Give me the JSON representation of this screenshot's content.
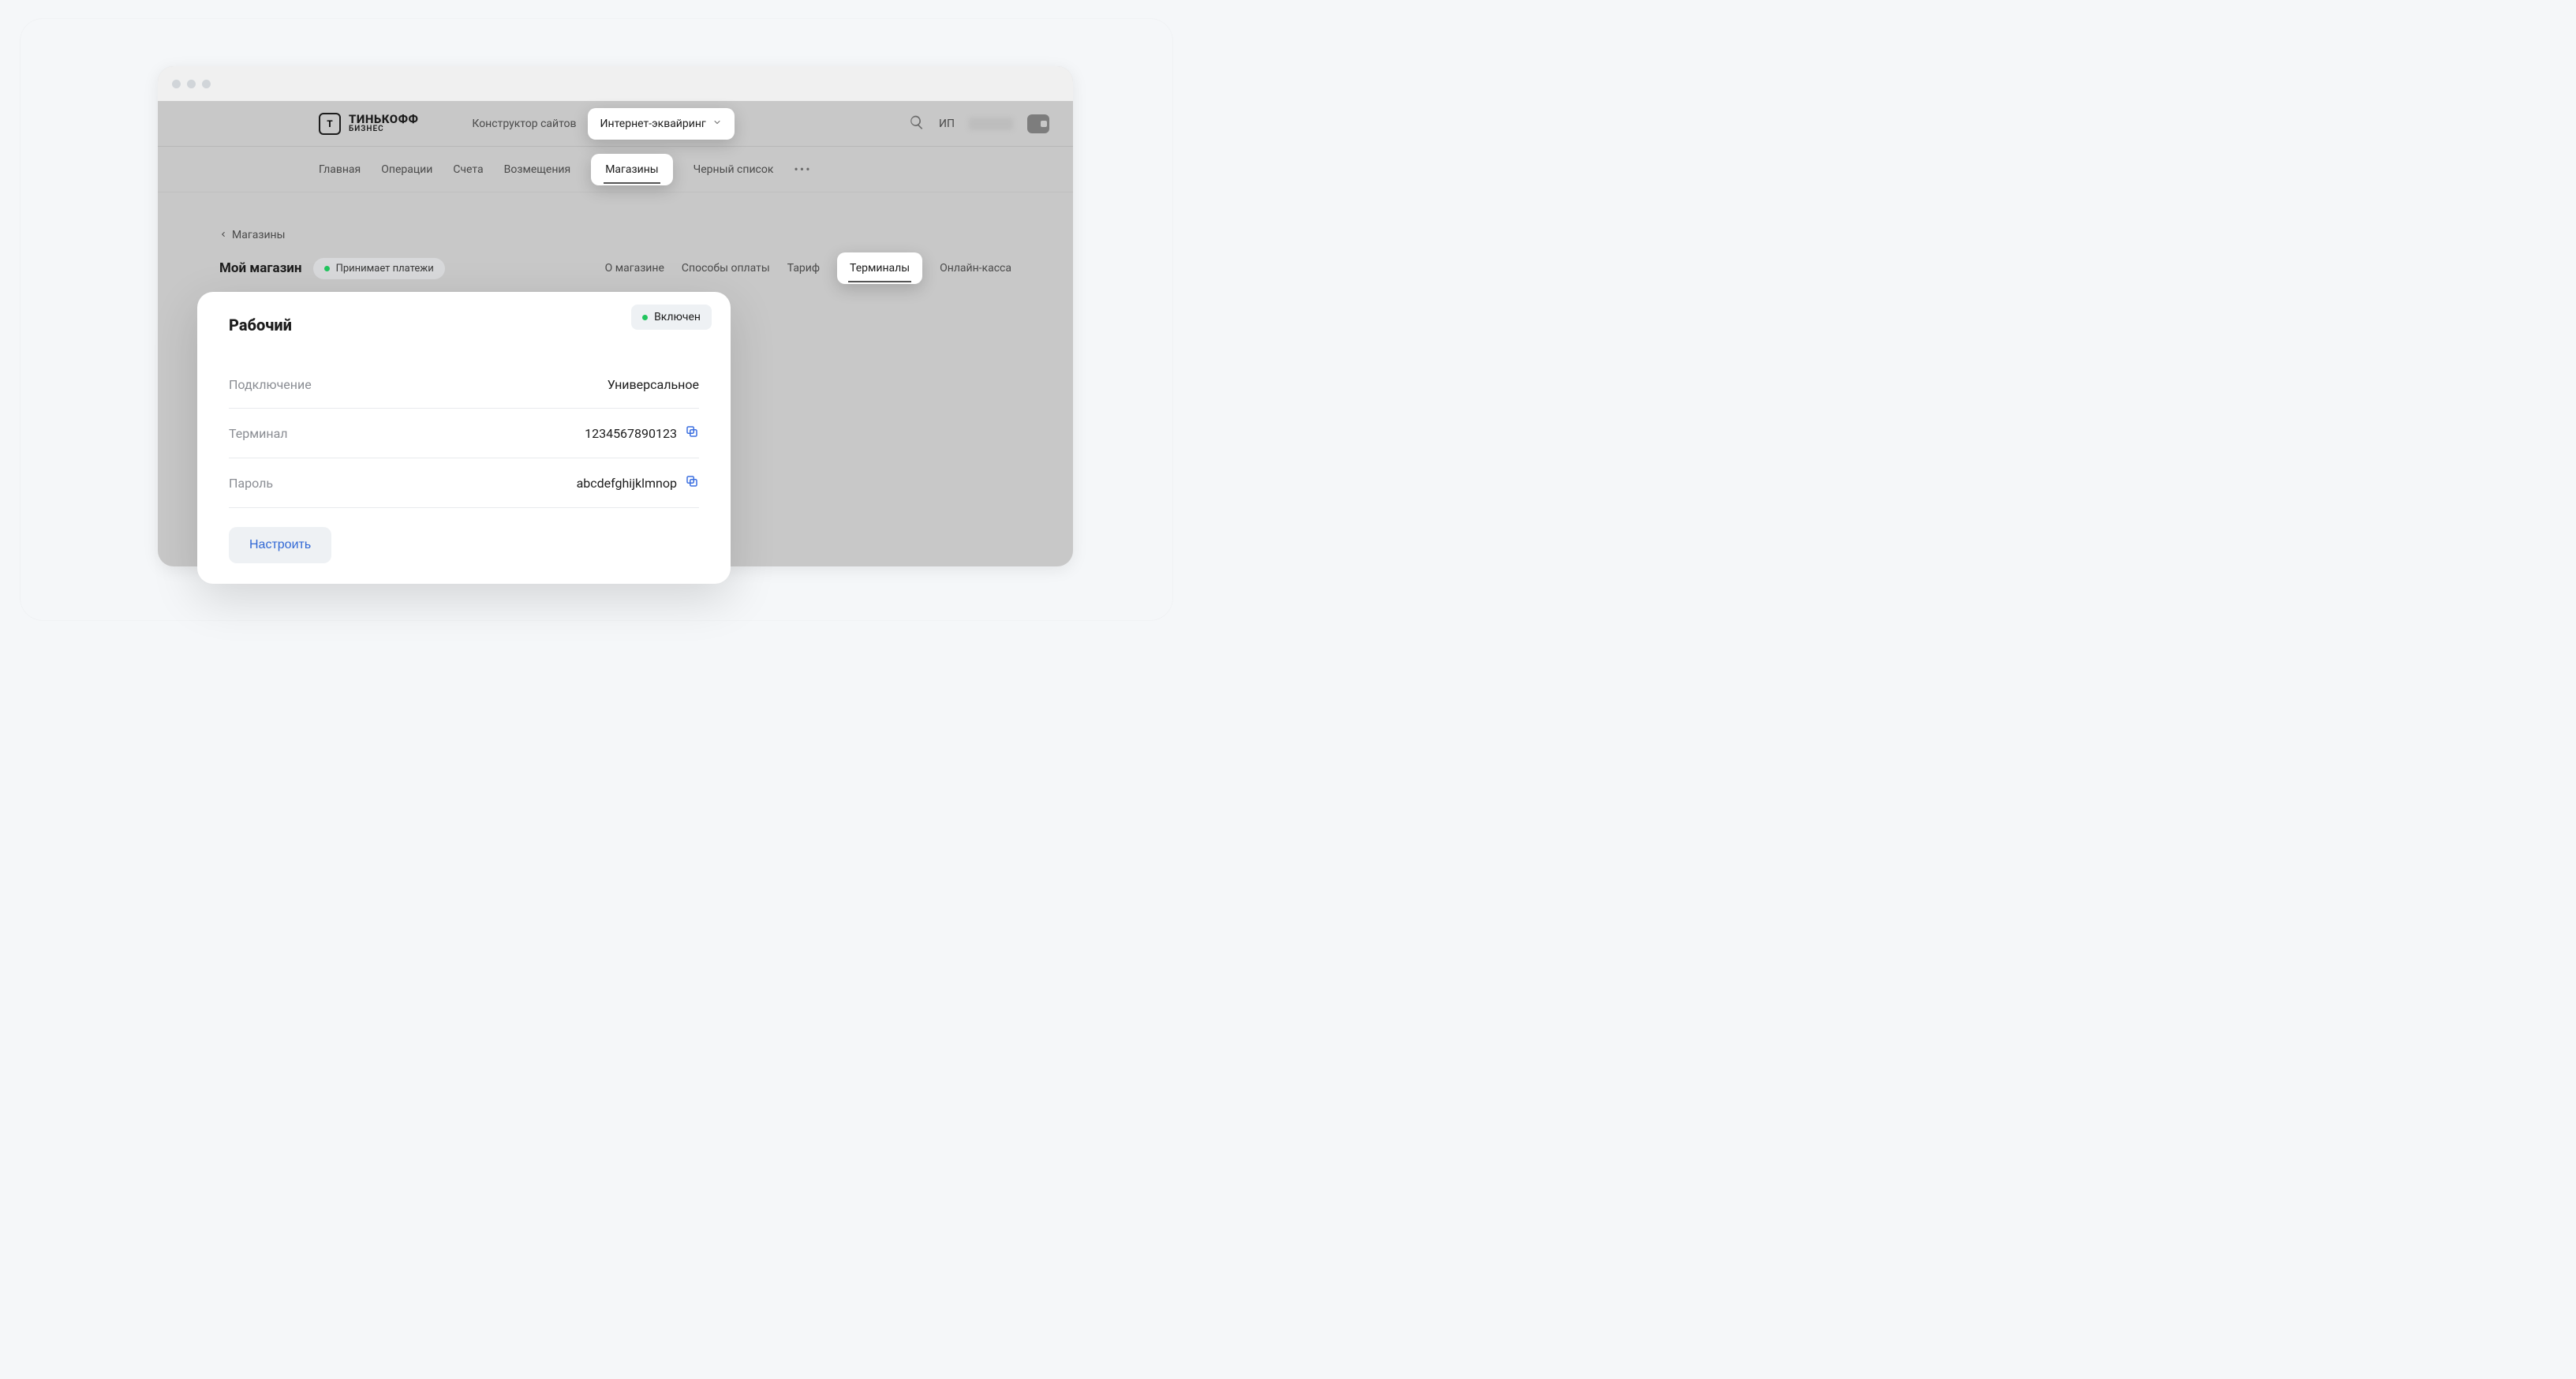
{
  "logo": {
    "line1": "ТИНЬКОФФ",
    "line2": "БИЗНЕС"
  },
  "primaryNav": {
    "link1": "Конструктор сайтов",
    "dropdown": "Интернет-эквайринг"
  },
  "user": {
    "prefix": "ИП"
  },
  "subnav": {
    "items": [
      "Главная",
      "Операции",
      "Счета",
      "Возмещения"
    ],
    "active": "Магазины",
    "after": "Черный список"
  },
  "breadcrumb": {
    "label": "Магазины"
  },
  "store": {
    "title": "Мой магазин",
    "statusLabel": "Принимает платежи"
  },
  "storeTabs": {
    "items": [
      "О магазине",
      "Способы оплаты",
      "Тариф"
    ],
    "active": "Терминалы",
    "after": "Онлайн-касса"
  },
  "card": {
    "title": "Рабочий",
    "badge": "Включен",
    "fields": {
      "connectionLabel": "Подключение",
      "connectionValue": "Универсальное",
      "terminalLabel": "Терминал",
      "terminalValue": "1234567890123",
      "passwordLabel": "Пароль",
      "passwordValue": "abcdefghijklmnop"
    },
    "configureLabel": "Настроить"
  }
}
